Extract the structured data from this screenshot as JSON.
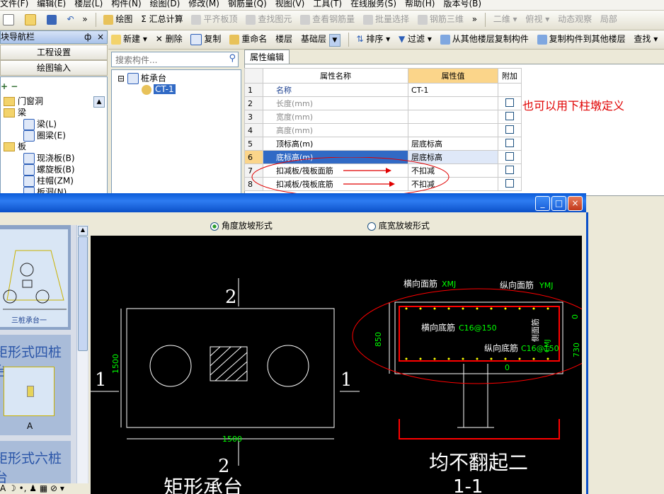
{
  "menu": [
    "文件(F)",
    "编辑(E)",
    "楼层(L)",
    "构件(N)",
    "绘图(D)",
    "修改(M)",
    "钢筋量(Q)",
    "视图(V)",
    "工具(T)",
    "在线服务(S)",
    "帮助(H)",
    "版本号(B)"
  ],
  "toolbar1": {
    "draw": "绘图",
    "summary": "汇总计算",
    "align_slab": "平齐板顶",
    "find": "查找图元",
    "view_rebar": "查看钢筋量",
    "batch_select": "批量选择",
    "rebar_3d": "钢筋三维",
    "view_2d": "二维",
    "top_view": "俯视",
    "dynamic_view": "动态观察",
    "local": "局部"
  },
  "nav": {
    "title": "模块导航栏",
    "pin": "ф",
    "close": "×",
    "project_settings": "工程设置",
    "draw_input": "绘图输入",
    "tree": [
      "门窗洞",
      "梁",
      "梁(L)",
      "圈梁(E)",
      "板",
      "现浇板(B)",
      "螺旋板(B)",
      "柱帽(ZM)",
      "板洞(N)"
    ]
  },
  "toolbar2": {
    "new": "新建",
    "delete": "删除",
    "copy": "复制",
    "rename": "重命名",
    "floor_label": "楼层",
    "floor_value": "基础层",
    "sort": "排序",
    "filter": "过滤",
    "copy_from": "从其他楼层复制构件",
    "copy_to": "复制构件到其他楼层",
    "search": "查找"
  },
  "search": {
    "placeholder": "搜索构件..."
  },
  "components": {
    "root": "桩承台",
    "child": "CT-1"
  },
  "property": {
    "tab": "属性编辑",
    "headers": [
      "属性名称",
      "属性值",
      "附加"
    ],
    "rows": [
      {
        "num": "1",
        "name": "名称",
        "value": "CT-1",
        "style": "link",
        "cb": false
      },
      {
        "num": "2",
        "name": "长度(mm)",
        "value": "",
        "style": "gray",
        "cb": true
      },
      {
        "num": "3",
        "name": "宽度(mm)",
        "value": "",
        "style": "gray",
        "cb": true
      },
      {
        "num": "4",
        "name": "高度(mm)",
        "value": "",
        "style": "gray",
        "cb": true
      },
      {
        "num": "5",
        "name": "顶标高(m)",
        "value": "层底标高",
        "style": "normal",
        "cb": true
      },
      {
        "num": "6",
        "name": "底标高(m)",
        "value": "层底标高",
        "style": "selected",
        "cb": true
      },
      {
        "num": "7",
        "name": "扣减板/筏板面筋",
        "value": "不扣减",
        "style": "normal",
        "cb": true
      },
      {
        "num": "8",
        "name": "扣减板/筏板底筋",
        "value": "不扣减",
        "style": "normal",
        "cb": true
      }
    ]
  },
  "annotation": "也可以用下柱墩定义",
  "dialog": {
    "option_angle": "角度放坡形式",
    "option_width": "底宽放坡形式",
    "selected_option": "angle",
    "thumbs": [
      "三桩承台一",
      "矩形式四桩台",
      "矩形式六桩台"
    ],
    "thumb_label_a": "A",
    "min_btn": "_",
    "max_btn": "□",
    "close_btn": "×"
  },
  "cad": {
    "section_mark": "2",
    "side_mark": "1",
    "dim_width": "1500",
    "dim_height": "1500",
    "plan_title": "矩形承台",
    "section_title": "均不翻起二",
    "section_label": "1-1",
    "top_trans": "横向面筋",
    "top_trans_code": "XMJ",
    "top_long": "纵向面筋",
    "top_long_code": "YMJ",
    "bot_trans": "横向底筋",
    "bot_trans_code": "C16@150",
    "bot_long": "纵向底筋",
    "bot_long_code": "C16@150",
    "side_bar": "侧面筋",
    "side_code": "CMJ",
    "dim_850": "850",
    "dim_730": "730",
    "dim_0a": "0",
    "dim_0b": "0"
  },
  "colors": {
    "cad_bg": "#000000",
    "cad_green": "#00ff00",
    "cad_yellow": "#ffff00",
    "cad_red": "#ff0000",
    "annotation": "#e00000"
  }
}
